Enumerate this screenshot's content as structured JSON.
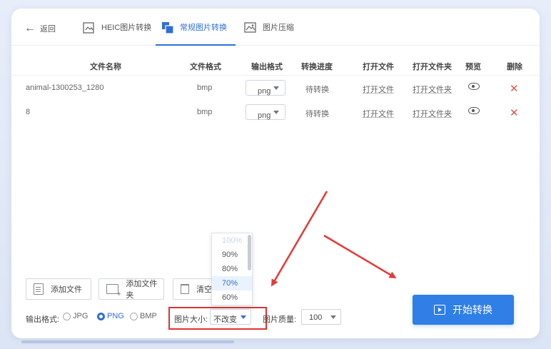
{
  "nav": {
    "back_label": "返回",
    "tabs": [
      {
        "label": "HEIC图片转换"
      },
      {
        "label": "常规图片转换"
      },
      {
        "label": "图片压缩"
      }
    ]
  },
  "table": {
    "headers": [
      "文件名称",
      "文件格式",
      "输出格式",
      "转换进度",
      "打开文件",
      "打开文件夹",
      "预览",
      "删除"
    ],
    "rows": [
      {
        "name": "animal-1300253_1280",
        "format": "bmp",
        "output": "png",
        "progress": "待转换",
        "open": "打开文件",
        "open_folder": "打开文件夹"
      },
      {
        "name": "8",
        "format": "bmp",
        "output": "png",
        "progress": "待转换",
        "open": "打开文件",
        "open_folder": "打开文件夹"
      }
    ]
  },
  "actions": {
    "add_file": "添加文件",
    "add_folder": "添加文件夹",
    "clear": "清空"
  },
  "options": {
    "output_format_label": "输出格式:",
    "formats": [
      "JPG",
      "PNG",
      "BMP"
    ],
    "selected_format": "PNG",
    "size_label": "图片大小:",
    "size_value": "不改变",
    "size_options": [
      "100%",
      "90%",
      "80%",
      "70%",
      "60%"
    ],
    "highlighted_size": "70%",
    "quality_label": "图片质量:",
    "quality_value": "100"
  },
  "start_button": "开始转换",
  "colors": {
    "accent": "#2f7fe6",
    "delete": "#e2554b",
    "highlight_box": "#dd3333",
    "arrow": "#e53935"
  }
}
